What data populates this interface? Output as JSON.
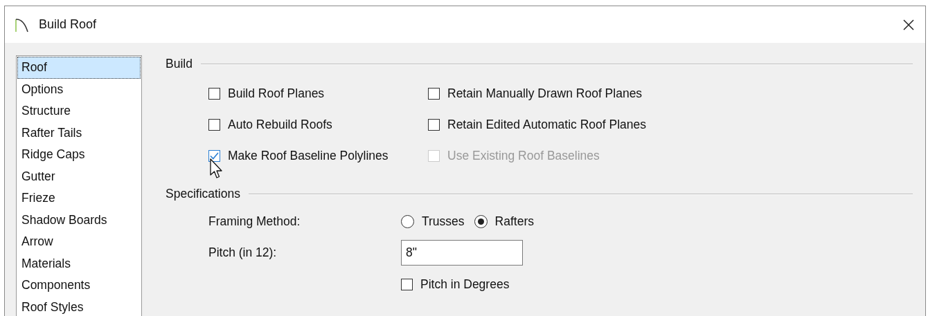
{
  "window": {
    "title": "Build Roof"
  },
  "sidebar": {
    "items": [
      {
        "label": "Roof",
        "selected": true
      },
      {
        "label": "Options",
        "selected": false
      },
      {
        "label": "Structure",
        "selected": false
      },
      {
        "label": "Rafter Tails",
        "selected": false
      },
      {
        "label": "Ridge Caps",
        "selected": false
      },
      {
        "label": "Gutter",
        "selected": false
      },
      {
        "label": "Frieze",
        "selected": false
      },
      {
        "label": "Shadow Boards",
        "selected": false
      },
      {
        "label": "Arrow",
        "selected": false
      },
      {
        "label": "Materials",
        "selected": false
      },
      {
        "label": "Components",
        "selected": false
      },
      {
        "label": "Roof Styles",
        "selected": false
      }
    ]
  },
  "build": {
    "title": "Build",
    "checkboxes": [
      {
        "label": "Build Roof Planes",
        "checked": false,
        "disabled": false
      },
      {
        "label": "Retain Manually Drawn Roof Planes",
        "checked": false,
        "disabled": false
      },
      {
        "label": "Auto Rebuild Roofs",
        "checked": false,
        "disabled": false
      },
      {
        "label": "Retain Edited Automatic Roof Planes",
        "checked": false,
        "disabled": false
      },
      {
        "label": "Make Roof Baseline Polylines",
        "checked": true,
        "disabled": false
      },
      {
        "label": "Use Existing Roof Baselines",
        "checked": false,
        "disabled": true
      }
    ]
  },
  "specifications": {
    "title": "Specifications",
    "framing_method": {
      "label": "Framing Method:",
      "options": [
        {
          "label": "Trusses",
          "selected": false
        },
        {
          "label": "Rafters",
          "selected": true
        }
      ]
    },
    "pitch": {
      "label": "Pitch (in 12):",
      "value": "8\""
    },
    "pitch_in_degrees": {
      "label": "Pitch in Degrees",
      "checked": false
    }
  }
}
